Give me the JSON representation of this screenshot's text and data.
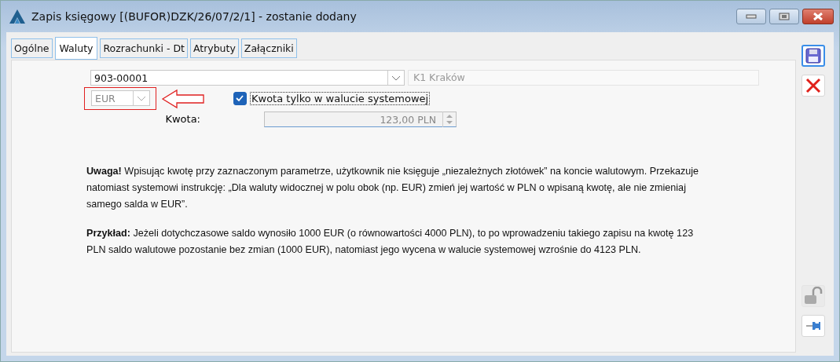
{
  "window": {
    "title": "Zapis księgowy [(BUFOR)DZK/26/07/2/1] - zostanie dodany"
  },
  "tabs": [
    {
      "label": "Ogólne",
      "selected": false
    },
    {
      "label": "Waluty",
      "selected": true
    },
    {
      "label": "Rozrachunki - Dt",
      "selected": false
    },
    {
      "label": "Atrybuty",
      "selected": false
    },
    {
      "label": "Załączniki",
      "selected": false
    }
  ],
  "account": {
    "value": "903-00001",
    "description": "K1 Kraków"
  },
  "currency": {
    "value": "EUR",
    "disabled": true
  },
  "system_currency_only": {
    "label": "Kwota tylko w walucie systemowej",
    "checked": true
  },
  "amount": {
    "label": "Kwota:",
    "value": "123,00 PLN",
    "disabled": true
  },
  "notes": [
    "**Uwaga!** Wpisując kwotę przy zaznaczonym parametrze, użytkownik nie księguje „niezależnych złotówek” na koncie walutowym. Przekazuje natomiast systemowi instrukcję: „Dla waluty widocznej w polu obok (np. EUR) zmień jej wartość w PLN o wpisaną kwotę, ale nie zmieniaj samego salda w EUR”.",
    "**Przykład:** Jeżeli dotychczasowe saldo wynosiło 1000 EUR (o równowartości 4000 PLN), to po wprowadzeniu takiego zapisu na kwotę 123 PLN saldo walutowe pozostanie bez zmian (1000 EUR), natomiast jego wycena w walucie systemowej wzrośnie do 4123 PLN."
  ]
}
